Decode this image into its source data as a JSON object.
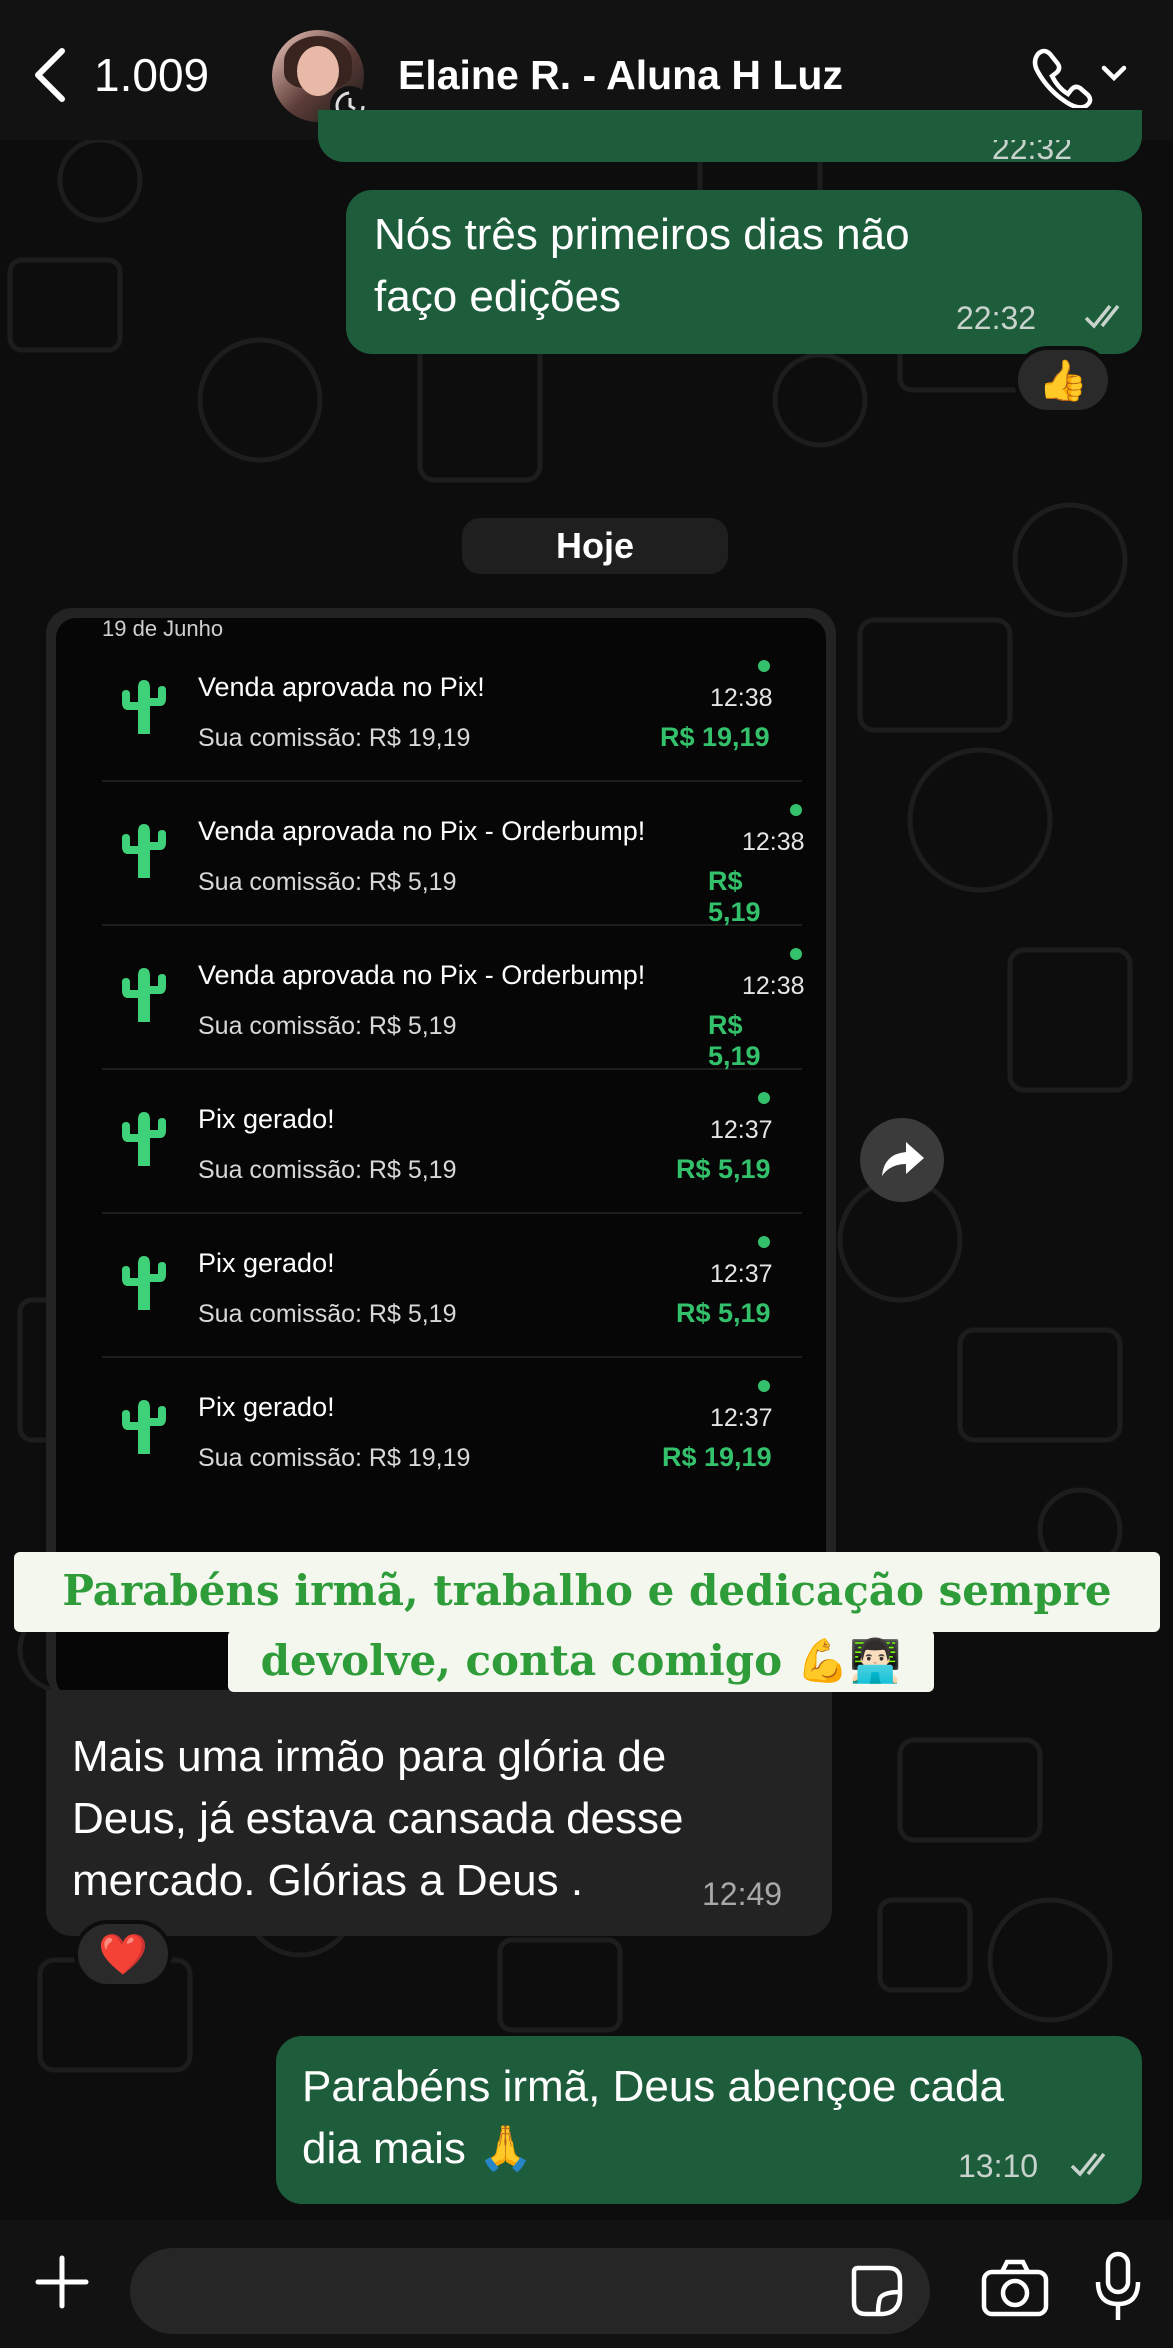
{
  "header": {
    "back_count": "1.009",
    "contact_name": "Elaine R. - Aluna H Luz"
  },
  "messages": {
    "m0_time": "22:32",
    "m1_text": "Nós três primeiros dias não faço edições",
    "m1_time": "22:32",
    "m1_reaction": "👍",
    "day_chip": "Hoje",
    "m2_text": "Mais uma irmão para glória de Deus, já estava cansada desse mercado. Glórias a Deus .",
    "m2_time": "12:49",
    "m2_reaction": "❤️",
    "m3_text": "Parabéns irmã, Deus abençoe cada dia mais 🙏",
    "m3_time": "13:10"
  },
  "screenshot": {
    "date_label": "19 de Junho",
    "notifications": [
      {
        "title": "Venda aprovada no Pix!",
        "subtitle": "Sua comissão: R$ 19,19",
        "time": "12:38",
        "amount": "R$ 19,19"
      },
      {
        "title": "Venda aprovada no Pix - Orderbump!",
        "subtitle": "Sua comissão: R$ 5,19",
        "time": "12:38",
        "amount": "R$ 5,19"
      },
      {
        "title": "Venda aprovada no Pix - Orderbump!",
        "subtitle": "Sua comissão: R$ 5,19",
        "time": "12:38",
        "amount": "R$ 5,19"
      },
      {
        "title": "Pix gerado!",
        "subtitle": "Sua comissão: R$ 5,19",
        "time": "12:37",
        "amount": "R$ 5,19"
      },
      {
        "title": "Pix gerado!",
        "subtitle": "Sua comissão: R$ 5,19",
        "time": "12:37",
        "amount": "R$ 5,19"
      },
      {
        "title": "Pix gerado!",
        "subtitle": "Sua comissão: R$ 19,19",
        "time": "12:37",
        "amount": "R$ 19,19"
      }
    ]
  },
  "caption": {
    "line1": "Parabéns irmã, trabalho e dedicação sempre",
    "line2": "devolve, conta comigo 💪👨🏻‍💻"
  },
  "colors": {
    "outgoing_bubble": "#1e5d3c",
    "incoming_bubble": "#222322",
    "accent_green": "#34c16c",
    "caption_text": "#2f9c3a"
  },
  "icons": [
    "chevron-left-icon",
    "phone-icon",
    "chevron-down-icon",
    "double-check-icon",
    "cactus-icon",
    "forward-icon",
    "plus-icon",
    "sticker-icon",
    "camera-icon",
    "mic-icon"
  ]
}
